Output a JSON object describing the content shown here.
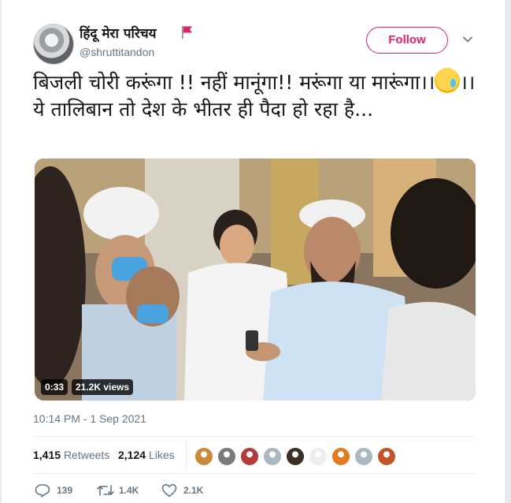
{
  "tweet": {
    "display_name": "हिंदू मेरा परिचय",
    "handle": "@shruttitandon",
    "follow_label": "Follow",
    "text_part1": "बिजली चोरी करूंगा !! नहीं मानूंगा!! मरूंगा या मारूंगा।।",
    "emoji": "crying-face-emoji",
    "text_part2": "।। ये तालिबान तो देश के भीतर ही पैदा हो रहा है...",
    "video_duration": "0:33",
    "video_views": "21.2K views",
    "timestamp": "10:14 PM - 1 Sep 2021"
  },
  "stats": {
    "retweets_count": "1,415",
    "retweets_label": "Retweets",
    "likes_count": "2,124",
    "likes_label": "Likes"
  },
  "likers": [
    {
      "name": "liker-avatar-1",
      "color": "#c98a3c"
    },
    {
      "name": "liker-avatar-2",
      "color": "#7a7a7a"
    },
    {
      "name": "liker-avatar-3",
      "color": "#b33a3a"
    },
    {
      "name": "liker-avatar-4",
      "color": "#aab8c2"
    },
    {
      "name": "liker-avatar-5",
      "color": "#3b3024"
    },
    {
      "name": "liker-avatar-6",
      "color": "#eeeeee"
    },
    {
      "name": "liker-avatar-7",
      "color": "#e07b24"
    },
    {
      "name": "liker-avatar-8",
      "color": "#aab8c2"
    },
    {
      "name": "liker-avatar-9",
      "color": "#c0542a"
    }
  ],
  "actions": {
    "reply_count": "139",
    "retweet_count": "1.4K",
    "like_count": "2.1K"
  },
  "colors": {
    "accent": "#e0245e",
    "muted_text": "#657786",
    "divider": "#e6ecf0",
    "flag": "#e0245e"
  }
}
